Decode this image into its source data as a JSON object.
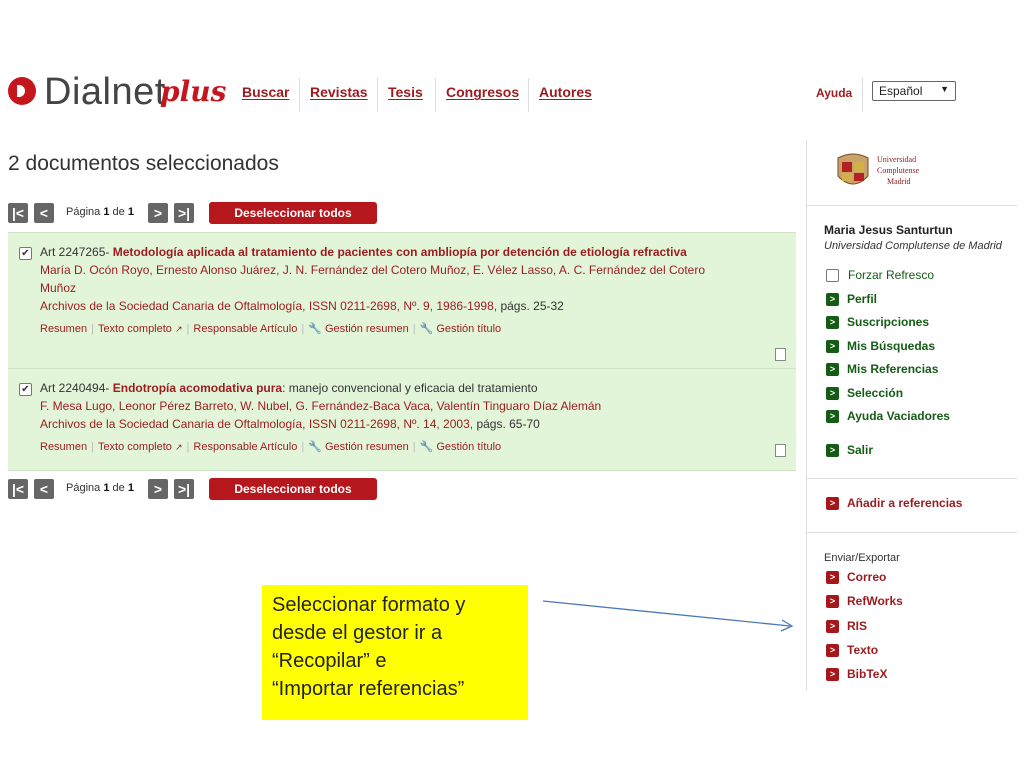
{
  "header": {
    "logo_text": "Dialnet",
    "logo_plus": "plus",
    "nav": [
      {
        "label": "Buscar"
      },
      {
        "label": "Revistas"
      },
      {
        "label": "Tesis"
      },
      {
        "label": "Congresos"
      },
      {
        "label": "Autores"
      }
    ],
    "help": "Ayuda",
    "language": "Español"
  },
  "main": {
    "title": "2 documentos seleccionados",
    "pager": {
      "prefix": "Página",
      "page": "1",
      "of": "de",
      "total": "1",
      "deselect_label": "Deseleccionar todos"
    },
    "results": [
      {
        "checked": true,
        "art_id": "Art 2247265-",
        "title": "Metodología aplicada al tratamiento de pacientes con ambliopía por detención de etiología refractiva",
        "subtitle": "",
        "authors": "María D. Ocón Royo, Ernesto Alonso Juárez, J. N. Fernández del Cotero Muñoz, E. Vélez Lasso, A. C. Fernández del Cotero Muñoz",
        "journal": "Archivos de la Sociedad Canaria de Oftalmología, ISSN 0211-2698, Nº. 9, 1986-1998,",
        "pages": "págs. 25-32",
        "links": [
          "Resumen",
          "Texto completo",
          "Responsable Artículo",
          "Gestión resumen",
          "Gestión título"
        ]
      },
      {
        "checked": true,
        "art_id": "Art 2240494-",
        "title": "Endotropía acomodativa pura",
        "subtitle": ": manejo convencional y eficacia del tratamiento",
        "authors": "F. Mesa Lugo, Leonor Pérez Barreto, W. Nubel, G. Fernández-Baca Vaca, Valentín Tinguaro Díaz Alemán",
        "journal": "Archivos de la Sociedad Canaria de Oftalmología, ISSN 0211-2698, Nº. 14, 2003,",
        "pages": "págs. 65-70",
        "links": [
          "Resumen",
          "Texto completo",
          "Responsable Artículo",
          "Gestión resumen",
          "Gestión título"
        ]
      }
    ]
  },
  "sidebar": {
    "university_logo_lines": [
      "Universidad",
      "Complutense",
      "Madrid"
    ],
    "user_name": "Maria Jesus Santurtun",
    "user_university": "Universidad Complutense de Madrid",
    "items": [
      {
        "label": "Forzar Refresco",
        "kind": "checkbox"
      },
      {
        "label": "Perfil"
      },
      {
        "label": "Suscripciones"
      },
      {
        "label": "Mis Búsquedas"
      },
      {
        "label": "Mis Referencias"
      },
      {
        "label": "Selección"
      },
      {
        "label": "Ayuda Vaciadores"
      },
      {
        "label": "Salir"
      }
    ],
    "add_references": "Añadir a referencias",
    "export_label": "Enviar/Exportar",
    "export_items": [
      {
        "label": "Correo"
      },
      {
        "label": "RefWorks"
      },
      {
        "label": "RIS"
      },
      {
        "label": "Texto"
      },
      {
        "label": "BibTeX"
      }
    ]
  },
  "annotation": {
    "lines": [
      "Seleccionar formato y",
      "desde el gestor ir a",
      "“Recopilar” e",
      "“Importar referencias”"
    ]
  },
  "colors": {
    "brand_red": "#c4161c",
    "link_red": "#9b1b1f",
    "result_bg": "#e2f5d9",
    "sidebar_green": "#145c15",
    "annotation_yellow": "#ffff00"
  }
}
